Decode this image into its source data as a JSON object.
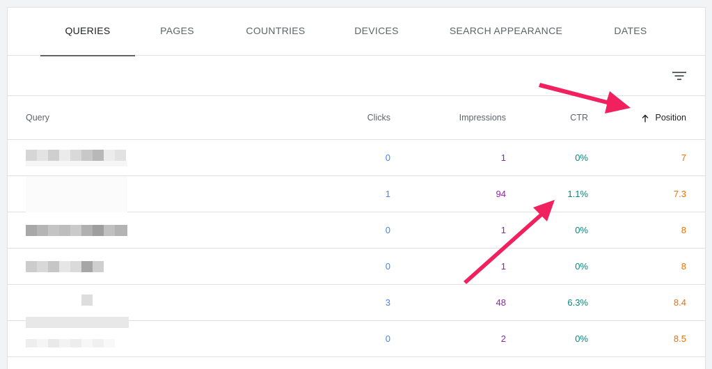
{
  "tabs": [
    {
      "label": "QUERIES",
      "active": true
    },
    {
      "label": "PAGES",
      "active": false
    },
    {
      "label": "COUNTRIES",
      "active": false
    },
    {
      "label": "DEVICES",
      "active": false
    },
    {
      "label": "SEARCH APPEARANCE",
      "active": false
    },
    {
      "label": "DATES",
      "active": false
    }
  ],
  "toolbar": {
    "filter_icon": "filter-list-icon"
  },
  "table": {
    "headers": {
      "query": "Query",
      "clicks": "Clicks",
      "impressions": "Impressions",
      "ctr": "CTR",
      "position": "Position",
      "sort_icon": "arrow-upward-icon"
    },
    "rows": [
      {
        "clicks": "0",
        "impressions": "1",
        "ctr": "0%",
        "position": "7"
      },
      {
        "clicks": "1",
        "impressions": "94",
        "ctr": "1.1%",
        "position": "7.3"
      },
      {
        "clicks": "0",
        "impressions": "1",
        "ctr": "0%",
        "position": "8"
      },
      {
        "clicks": "0",
        "impressions": "1",
        "ctr": "0%",
        "position": "8"
      },
      {
        "clicks": "3",
        "impressions": "48",
        "ctr": "6.3%",
        "position": "8.4"
      },
      {
        "clicks": "0",
        "impressions": "2",
        "ctr": "0%",
        "position": "8.5"
      }
    ]
  },
  "colors": {
    "clicks": "#4285f4",
    "impressions": "#8e24aa",
    "ctr": "#00897b",
    "position": "#e8710a",
    "annotation_arrow": "#f0215e"
  }
}
